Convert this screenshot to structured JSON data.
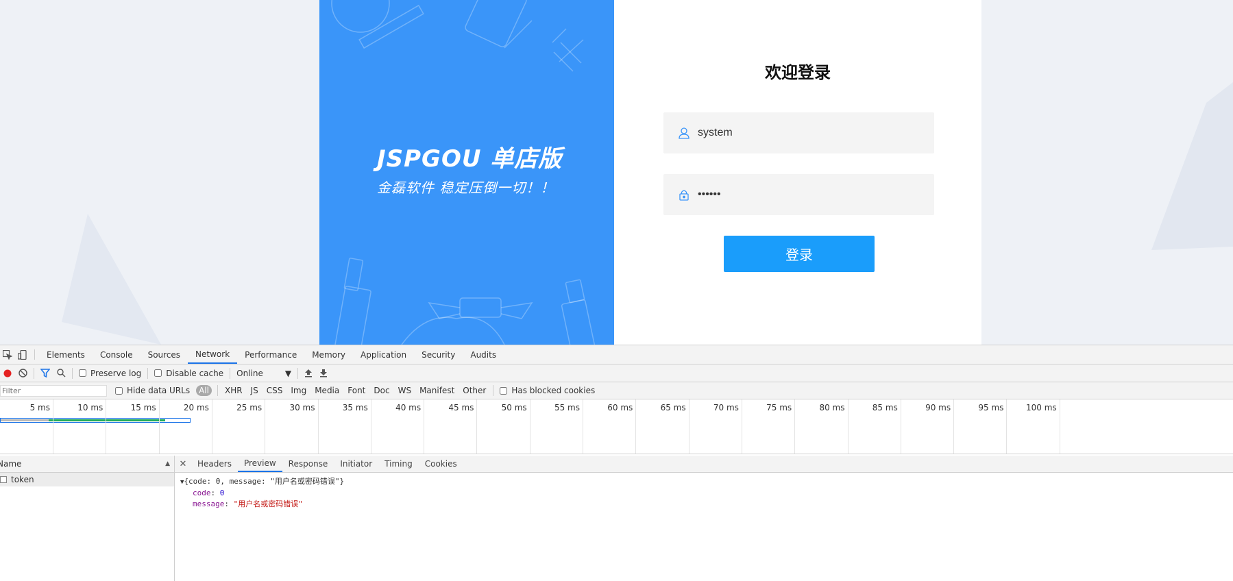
{
  "login": {
    "brand_title": "JSPGOU 单店版",
    "brand_slogan": "金磊软件 稳定压倒一切！！",
    "heading": "欢迎登录",
    "username_value": "system",
    "password_value": "••••••",
    "login_button": "登录",
    "colors": {
      "brand_panel": "#3a95f9",
      "login_button": "#1a9dfb"
    }
  },
  "devtools": {
    "tabs": [
      "Elements",
      "Console",
      "Sources",
      "Network",
      "Performance",
      "Memory",
      "Application",
      "Security",
      "Audits"
    ],
    "active_tab": "Network",
    "toolbar": {
      "preserve_log": "Preserve log",
      "disable_cache": "Disable cache",
      "throttling": "Online"
    },
    "filterbar": {
      "filter_placeholder": "Filter",
      "hide_data_urls": "Hide data URLs",
      "types": [
        "All",
        "XHR",
        "JS",
        "CSS",
        "Img",
        "Media",
        "Font",
        "Doc",
        "WS",
        "Manifest",
        "Other"
      ],
      "has_blocked_cookies": "Has blocked cookies"
    },
    "timeline_ticks": [
      "5 ms",
      "10 ms",
      "15 ms",
      "20 ms",
      "25 ms",
      "30 ms",
      "35 ms",
      "40 ms",
      "45 ms",
      "50 ms",
      "55 ms",
      "60 ms",
      "65 ms",
      "70 ms",
      "75 ms",
      "80 ms",
      "85 ms",
      "90 ms",
      "95 ms",
      "100 ms"
    ],
    "request_list": {
      "header": "Name",
      "rows": [
        "token"
      ]
    },
    "detail_tabs": [
      "Headers",
      "Preview",
      "Response",
      "Initiator",
      "Timing",
      "Cookies"
    ],
    "active_detail_tab": "Preview",
    "preview": {
      "summary": "{code: 0, message: \"用户名或密码错误\"}",
      "code_key": "code",
      "code_value": "0",
      "message_key": "message",
      "message_value": "\"用户名或密码错误\""
    }
  }
}
